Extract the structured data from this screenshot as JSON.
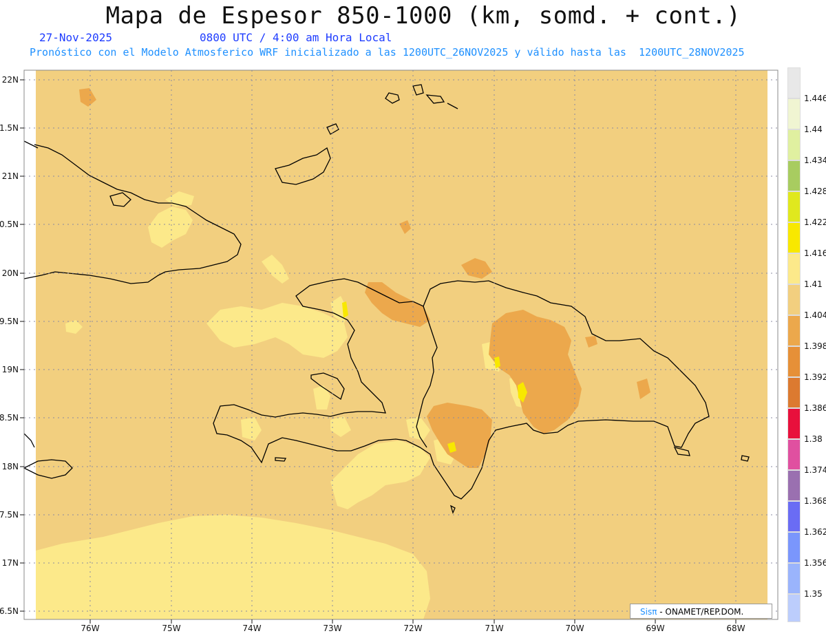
{
  "header": {
    "title": "Mapa de Espesor 850-1000 (km, somd. + cont.)",
    "date": "27-Nov-2025",
    "time": "0800 UTC / 4:00 am Hora Local",
    "forecast": "Pronóstico con el Modelo Atmosferico WRF inicializado a las 1200UTC_26NOV2025 y válido hasta las  1200UTC_28NOV2025"
  },
  "map": {
    "lat_labels": [
      "22N",
      "1.5N",
      "21N",
      "0.5N",
      "20N",
      "9.5N",
      "19N",
      "8.5N",
      "18N",
      "7.5N",
      "17N",
      "6.5N"
    ],
    "lon_labels": [
      "76W",
      "75W",
      "74W",
      "73W",
      "72W",
      "71W",
      "70W",
      "69W",
      "68W"
    ],
    "base_color": "#f2cf7f"
  },
  "legend": {
    "labels": [
      "1.446",
      "1.44",
      "1.434",
      "1.428",
      "1.422",
      "1.416",
      "1.41",
      "1.404",
      "1.398",
      "1.392",
      "1.386",
      "1.38",
      "1.374",
      "1.368",
      "1.362",
      "1.356",
      "1.35"
    ],
    "colors": [
      "#e8e8e8",
      "#f0f5d2",
      "#e0f0a0",
      "#a8cc60",
      "#e0e81e",
      "#f8e800",
      "#fce98a",
      "#f2cf7f",
      "#eca84c",
      "#e69038",
      "#dc7a30",
      "#e8103c",
      "#e050a0",
      "#9a70b0",
      "#6a6cf4",
      "#7a96fc",
      "#9ab4fc",
      "#bccdfc"
    ]
  },
  "credit": {
    "sis": "Sis",
    "pi": "π",
    "text": "- ONAMET/REP.DOM."
  }
}
